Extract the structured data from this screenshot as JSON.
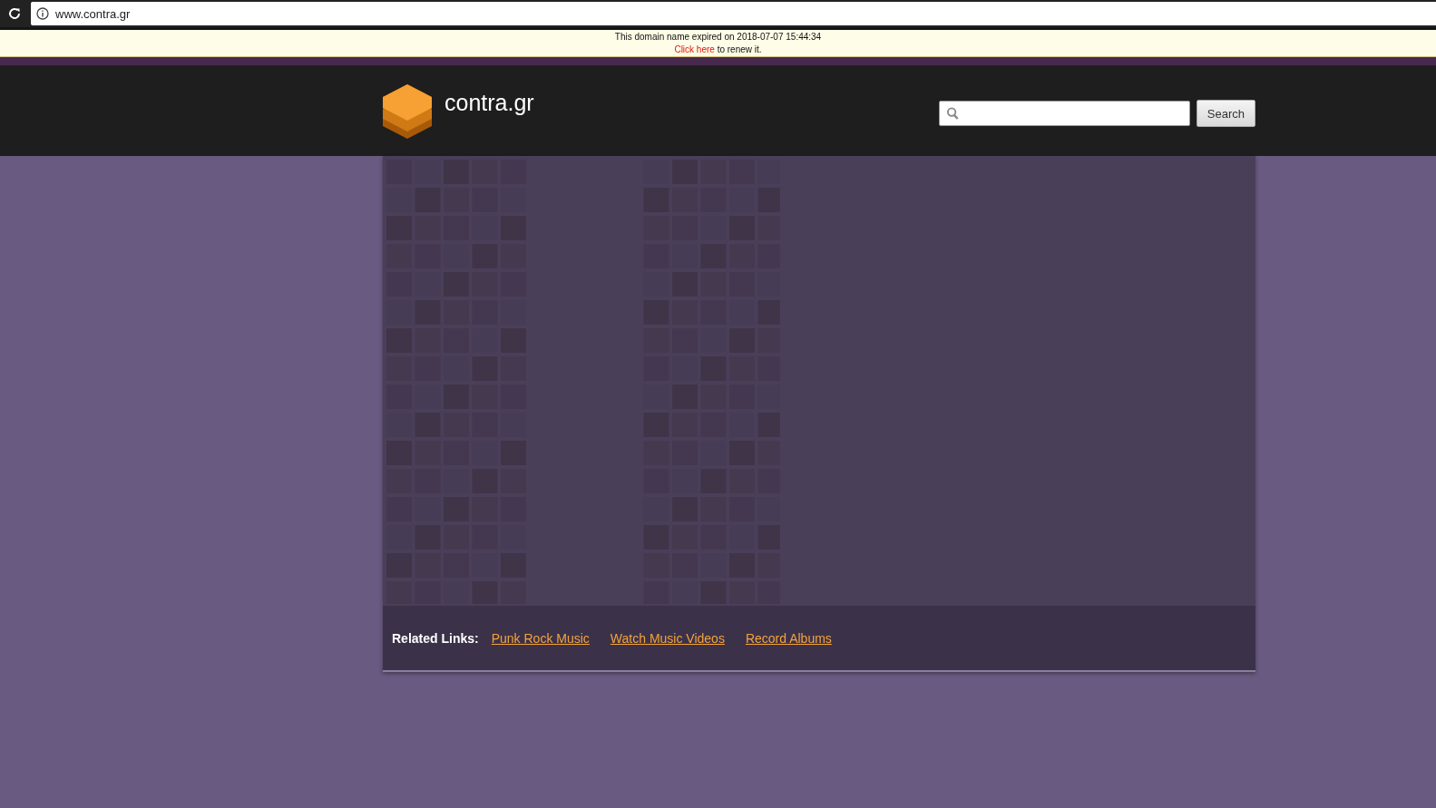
{
  "browser": {
    "url": "www.contra.gr"
  },
  "notice": {
    "message": "This domain name expired on 2018-07-07 15:44:34",
    "link": "Click here",
    "suffix": " to renew it."
  },
  "header": {
    "site_name": "contra.gr",
    "search": {
      "button": "Search"
    }
  },
  "related_links": {
    "label": "Related Links:",
    "links": [
      "Punk Rock Music",
      "Watch Music Videos",
      "Record Albums"
    ]
  }
}
